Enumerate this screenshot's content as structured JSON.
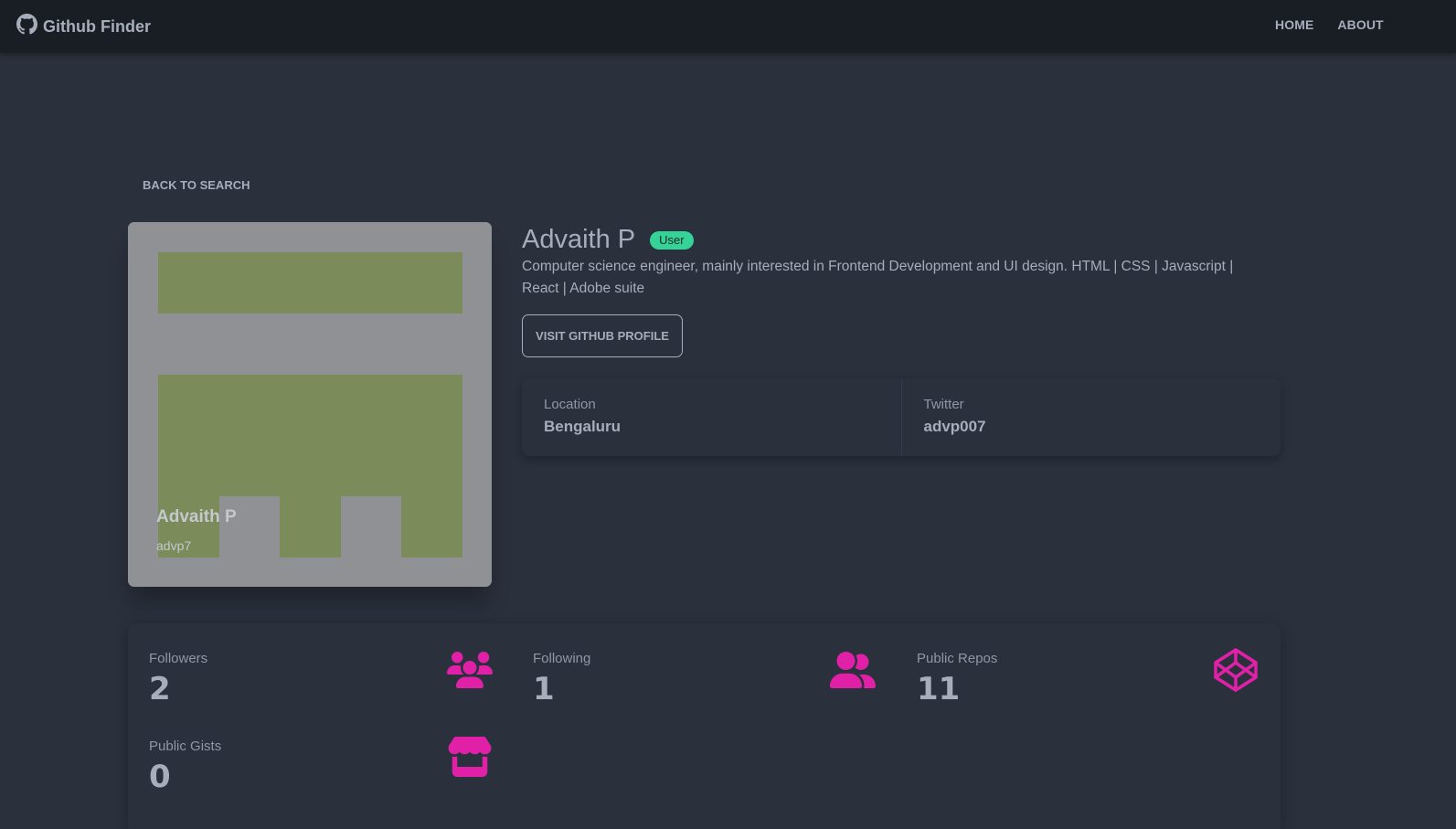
{
  "navbar": {
    "brand": "Github Finder",
    "links": [
      "HOME",
      "ABOUT"
    ]
  },
  "back_link": "BACK TO SEARCH",
  "avatar": {
    "name": "Advaith P",
    "login": "advp7"
  },
  "profile": {
    "name": "Advaith P",
    "badge": "User",
    "bio": "Computer science engineer, mainly interested in Frontend Development and UI design. HTML | CSS | Javascript | React | Adobe suite",
    "visit_button": "VISIT GITHUB PROFILE"
  },
  "info": [
    {
      "title": "Location",
      "value": "Bengaluru"
    },
    {
      "title": "Twitter",
      "value": "advp007"
    }
  ],
  "counts": [
    {
      "title": "Followers",
      "value": "2",
      "icon": "users-icon"
    },
    {
      "title": "Following",
      "value": "1",
      "icon": "user-friends-icon"
    },
    {
      "title": "Public Repos",
      "value": "11",
      "icon": "codepen-icon"
    },
    {
      "title": "Public Gists",
      "value": "0",
      "icon": "store-icon"
    }
  ],
  "colors": {
    "background": "#2a303c",
    "navbar": "#191d24",
    "accent": "#e021a8",
    "badge": "#36d399",
    "identicon": "#7b8b59",
    "avatar_bg": "#909195"
  }
}
